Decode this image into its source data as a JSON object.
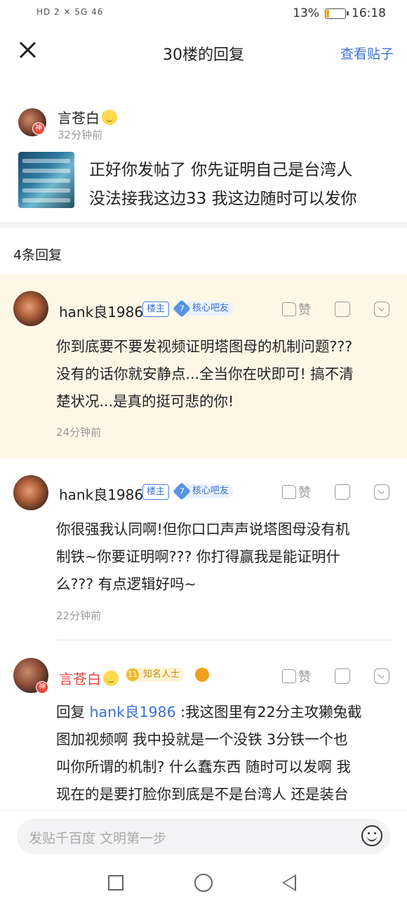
{
  "status_bar": {
    "network": "HD 2 ✕ 5G 46",
    "battery_pct": "13%",
    "battery_level": 0.13,
    "time": "16:18"
  },
  "header": {
    "title": "30楼的回复",
    "view_post": "查看贴子"
  },
  "op": {
    "name": "言苍白",
    "badge": "神",
    "time": "32分钟前",
    "text_line1": "正好你发帖了 你先证明自己是台湾人",
    "text_line2": "没法接我这边33 我这边随时可以发你"
  },
  "replies_count": "4条回复",
  "replies": [
    {
      "name": "hank良1986",
      "tag": "楼主",
      "level": "7",
      "level_title": "核心吧友",
      "like_label": "赞",
      "lines": [
        "你到底要不要发视频证明塔图母的机制问题???",
        "没有的话你就安静点...全当你在吠即可! 搞不清",
        "楚状况...是真的挺可悲的你!"
      ],
      "time": "24分钟前",
      "highlight_bg": "#fdf8e6"
    },
    {
      "name": "hank良1986",
      "tag": "楼主",
      "level": "7",
      "level_title": "核心吧友",
      "like_label": "赞",
      "lines": [
        "你很强我认同啊!但你口口声声说塔图母没有机",
        "制铁~你要证明啊??? 你打得赢我是能证明什",
        "么??? 有点逻辑好吗~"
      ],
      "time": "22分钟前"
    },
    {
      "name": "言苍白",
      "badge": "神",
      "level": "11",
      "level_title": "知名人士",
      "like_label": "赞",
      "reply_prefix": "回复 ",
      "reply_to": "hank良1986",
      "lines": [
        " :我这图里有22分主攻獭兔截",
        "图加视频啊 我中投就是一个没铁 3分铁一个也",
        "叫你所谓的机制? 什么蠢东西 随时可以发啊 我",
        "现在的是要打脸你到底是不是台湾人 还是装台"
      ]
    }
  ],
  "input": {
    "placeholder": "发贴千百度 文明第一步"
  },
  "colors": {
    "accent": "#3b73d6",
    "name_red": "#e5483e",
    "highlight": "#fdf8e6"
  }
}
